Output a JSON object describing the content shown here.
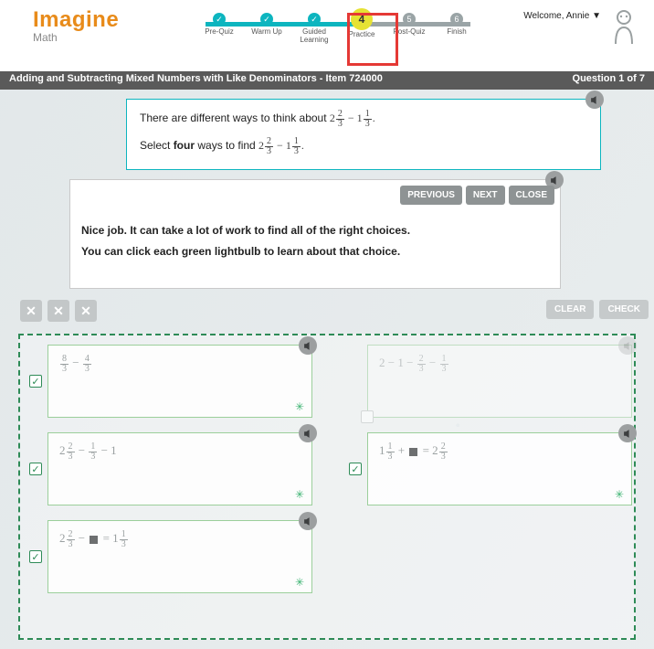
{
  "brand": {
    "line1": "Imagine",
    "line2": "Math"
  },
  "welcome": "Welcome, Annie ▼",
  "steps": [
    {
      "label": "Pre-Quiz"
    },
    {
      "label": "Warm Up"
    },
    {
      "label": "Guided Learning"
    },
    {
      "label": "Practice",
      "num": "4"
    },
    {
      "label": "Post-Quiz"
    },
    {
      "label": "Finish"
    }
  ],
  "titlebar": {
    "left": "Adding and Subtracting Mixed Numbers with Like Denominators - Item 724000",
    "right": "Question 1 of 7"
  },
  "prompt": {
    "p1a": "There are different ways to think about ",
    "p2a": "Select ",
    "p2b": "four",
    "p2c": " ways to find "
  },
  "feedback": {
    "previous": "PREVIOUS",
    "next": "NEXT",
    "close": "CLOSE",
    "line1": "Nice job. It can take a lot of work to find all of the right choices.",
    "line2": "You can click each green lightbulb to learn about that choice."
  },
  "side": {
    "clear": "CLEAR",
    "check": "CHECK"
  }
}
